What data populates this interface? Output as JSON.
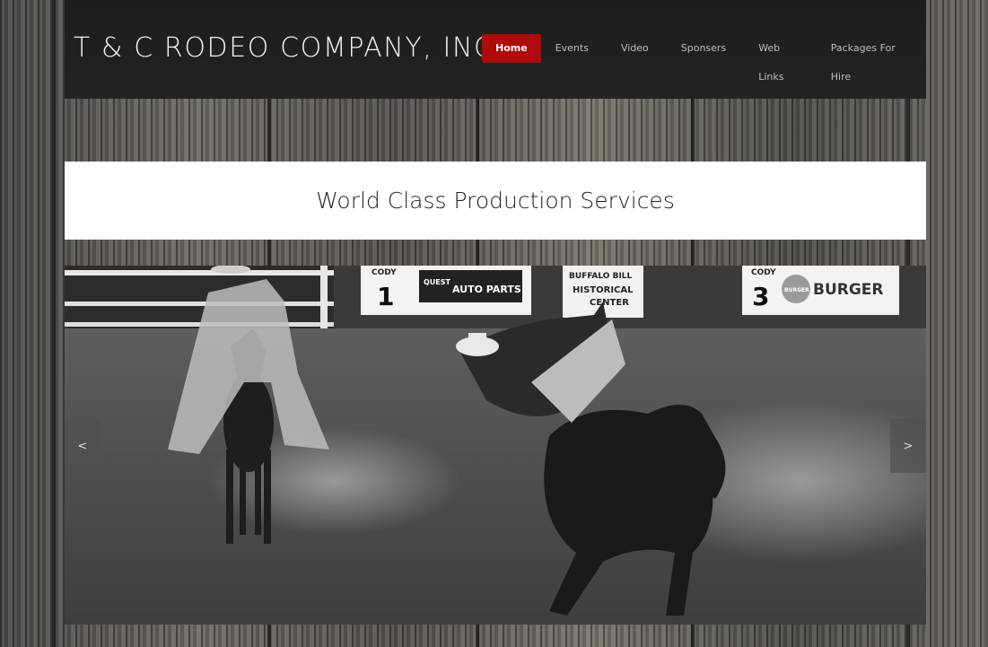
{
  "site": {
    "logo_text": "T & C RODEO COMPANY, INC."
  },
  "nav": {
    "items": [
      {
        "label": "Home",
        "active": true
      },
      {
        "label": "Events"
      },
      {
        "label": "Video"
      },
      {
        "label": "Sponsers"
      },
      {
        "label": "Web Links"
      },
      {
        "label": "Packages For Hire"
      }
    ]
  },
  "banner": {
    "title": "World Class Production Services"
  },
  "slider": {
    "prev_label": "<",
    "next_label": ">",
    "signs": [
      {
        "number": "1",
        "town": "CODY",
        "text": "AUTO PARTS",
        "brand": "QUEST"
      },
      {
        "line1": "BUFFALO BILL",
        "line2": "HISTORICAL",
        "line3": "CENTER"
      },
      {
        "number": "3",
        "town": "CODY",
        "text": "BURGER",
        "brand": "BURGER KING"
      }
    ]
  },
  "colors": {
    "header_bg": "#1d1d1d",
    "nav_active_bg": "#b00a0a",
    "nav_text": "#bdbdbd",
    "banner_bg": "#ffffff"
  }
}
